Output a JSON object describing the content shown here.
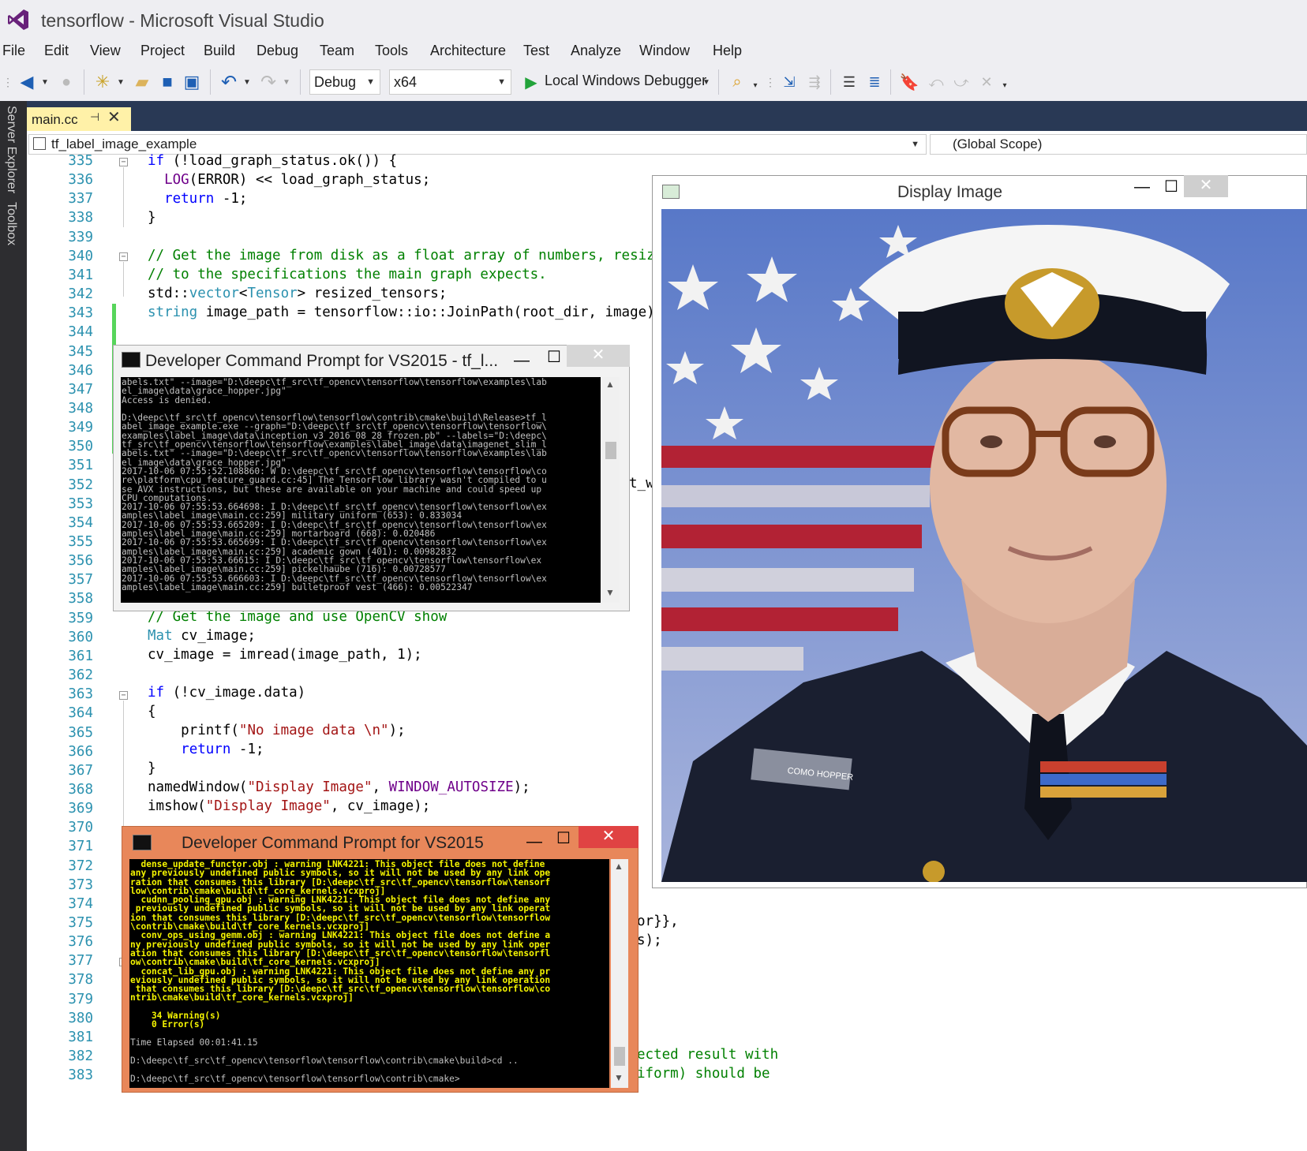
{
  "window": {
    "title": "tensorflow - Microsoft Visual Studio"
  },
  "menu": [
    "File",
    "Edit",
    "View",
    "Project",
    "Build",
    "Debug",
    "Team",
    "Tools",
    "Architecture",
    "Test",
    "Analyze",
    "Window",
    "Help"
  ],
  "toolbar": {
    "configuration": "Debug",
    "platform": "x64",
    "debugger": "Local Windows Debugger"
  },
  "side_tabs": [
    "Server Explorer",
    "Toolbox"
  ],
  "editor_tab": {
    "label": "main.cc"
  },
  "navigation": {
    "project": "tf_label_image_example",
    "scope": "(Global Scope)"
  },
  "line_numbers": [
    "335",
    "336",
    "337",
    "338",
    "339",
    "340",
    "341",
    "342",
    "343",
    "344",
    "345",
    "346",
    "347",
    "348",
    "349",
    "350",
    "351",
    "352",
    "353",
    "354",
    "355",
    "356",
    "357",
    "358",
    "359",
    "360",
    "361",
    "362",
    "363",
    "364",
    "365",
    "366",
    "367",
    "368",
    "369",
    "370",
    "371",
    "372",
    "373",
    "374",
    "375",
    "376",
    "377",
    "378",
    "379",
    "380",
    "381",
    "382",
    "383"
  ],
  "code_fragments": {
    "l352_tail": "t_w",
    "l375_tail": "or}},",
    "l376_tail": "s);",
    "l382_tail": "ected result with",
    "l383_tail": "iform) should be"
  },
  "display_window": {
    "title": "Display Image",
    "photo_caption": "COMO HOPPER"
  },
  "cmd_window_1": {
    "title": "Developer Command Prompt for VS2015 - tf_l...",
    "lines": [
      "abels.txt\" --image=\"D:\\deepc\\tf_src\\tf_opencv\\tensorflow\\tensorflow\\examples\\lab",
      "el_image\\data\\grace_hopper.jpg\"",
      "Access is denied.",
      "",
      "D:\\deepc\\tf_src\\tf_opencv\\tensorflow\\tensorflow\\contrib\\cmake\\build\\Release>tf_l",
      "abel_image_example.exe --graph=\"D:\\deepc\\tf_src\\tf_opencv\\tensorflow\\tensorflow\\",
      "examples\\label_image\\data\\inception_v3_2016_08_28_frozen.pb\" --labels=\"D:\\deepc\\",
      "tf_src\\tf_opencv\\tensorflow\\tensorflow\\examples\\label_image\\data\\imagenet_slim_l",
      "abels.txt\" --image=\"D:\\deepc\\tf_src\\tf_opencv\\tensorflow\\tensorflow\\examples\\lab",
      "el_image\\data\\grace_hopper.jpg\"",
      "2017-10-06 07:55:52.108860: W D:\\deepc\\tf_src\\tf_opencv\\tensorflow\\tensorflow\\co",
      "re\\platform\\cpu_feature_guard.cc:45] The TensorFlow library wasn't compiled to u",
      "se AVX instructions, but these are available on your machine and could speed up",
      "CPU computations.",
      "2017-10-06 07:55:53.664698: I D:\\deepc\\tf_src\\tf_opencv\\tensorflow\\tensorflow\\ex",
      "amples\\label_image\\main.cc:259] military uniform (653): 0.833034",
      "2017-10-06 07:55:53.665209: I D:\\deepc\\tf_src\\tf_opencv\\tensorflow\\tensorflow\\ex",
      "amples\\label_image\\main.cc:259] mortarboard (668): 0.020486",
      "2017-10-06 07:55:53.665699: I D:\\deepc\\tf_src\\tf_opencv\\tensorflow\\tensorflow\\ex",
      "amples\\label_image\\main.cc:259] academic gown (401): 0.00982832",
      "2017-10-06 07:55:53.66615: I D:\\deepc\\tf_src\\tf_opencv\\tensorflow\\tensorflow\\ex",
      "amples\\label_image\\main.cc:259] pickelhaube (716): 0.00728577",
      "2017-10-06 07:55:53.666603: I D:\\deepc\\tf_src\\tf_opencv\\tensorflow\\tensorflow\\ex",
      "amples\\label_image\\main.cc:259] bulletproof vest (466): 0.00522347"
    ]
  },
  "cmd_window_2": {
    "title": "Developer Command Prompt for VS2015",
    "warning_lines": [
      "  dense_update_functor.obj : warning LNK4221: This object file does not define",
      "any previously undefined public symbols, so it will not be used by any link ope",
      "ration that consumes this library [D:\\deepc\\tf_src\\tf_opencv\\tensorflow\\tensorf",
      "low\\contrib\\cmake\\build\\tf_core_kernels.vcxproj]",
      "  cudnn_pooling_gpu.obj : warning LNK4221: This object file does not define any",
      " previously undefined public symbols, so it will not be used by any link operat",
      "ion that consumes this library [D:\\deepc\\tf_src\\tf_opencv\\tensorflow\\tensorflow",
      "\\contrib\\cmake\\build\\tf_core_kernels.vcxproj]",
      "  conv_ops_using_gemm.obj : warning LNK4221: This object file does not define a",
      "ny previously undefined public symbols, so it will not be used by any link oper",
      "ation that consumes this library [D:\\deepc\\tf_src\\tf_opencv\\tensorflow\\tensorfl",
      "ow\\contrib\\cmake\\build\\tf_core_kernels.vcxproj]",
      "  concat_lib_gpu.obj : warning LNK4221: This object file does not define any pr",
      "eviously undefined public symbols, so it will not be used by any link operation",
      " that consumes this library [D:\\deepc\\tf_src\\tf_opencv\\tensorflow\\tensorflow\\co",
      "ntrib\\cmake\\build\\tf_core_kernels.vcxproj]",
      "",
      "    34 Warning(s)",
      "    0 Error(s)"
    ],
    "elapsed": "Time Elapsed 00:01:41.15",
    "prompt_1": "D:\\deepc\\tf_src\\tf_opencv\\tensorflow\\tensorflow\\contrib\\cmake\\build>cd ..",
    "prompt_2": "D:\\deepc\\tf_src\\tf_opencv\\tensorflow\\tensorflow\\contrib\\cmake>"
  }
}
